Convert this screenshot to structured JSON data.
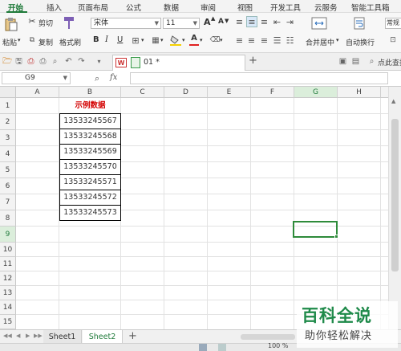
{
  "menu": {
    "tabs": [
      "开始",
      "插入",
      "页面布局",
      "公式",
      "数据",
      "审阅",
      "视图",
      "开发工具",
      "云服务",
      "智能工具箱"
    ],
    "active_index": 0
  },
  "ribbon": {
    "paste": "粘贴",
    "cut": "剪切",
    "copy": "复制",
    "format_painter": "格式刷",
    "font_name": "宋体",
    "font_size": "11",
    "bold": "B",
    "italic": "I",
    "underline": "U",
    "grow_font": "A",
    "shrink_font": "A",
    "font_color_letter": "A",
    "merge_center": "合并居中",
    "wrap_text": "自动换行",
    "right_cut_label": "常规"
  },
  "tabstrip": {
    "doc_name": "01 *",
    "add_tab": "+",
    "right_label": "点此查找"
  },
  "formula_bar": {
    "name_box": "G9",
    "fx_label": "fx",
    "formula": ""
  },
  "grid": {
    "columns": [
      "A",
      "B",
      "C",
      "D",
      "E",
      "F",
      "G",
      "H"
    ],
    "rows": [
      "1",
      "2",
      "3",
      "4",
      "5",
      "6",
      "7",
      "8",
      "9",
      "10",
      "11",
      "12",
      "13",
      "14",
      "15"
    ],
    "header_cell": "示例数据",
    "values": [
      "13533245567",
      "13533245568",
      "13533245569",
      "13533245570",
      "13533245571",
      "13533245572",
      "13533245573"
    ],
    "selected_cell": "G9",
    "selected_col": "G",
    "selected_row": "9",
    "accent_color": "#2e8b3a",
    "header_text_color": "#d40000"
  },
  "sheets": {
    "tabs": [
      "Sheet1",
      "Sheet2"
    ],
    "active_index": 1,
    "add_label": "+"
  },
  "status": {
    "zoom": "100 %"
  },
  "watermark": {
    "title": "百科全说",
    "subtitle": "助你轻松解决"
  }
}
